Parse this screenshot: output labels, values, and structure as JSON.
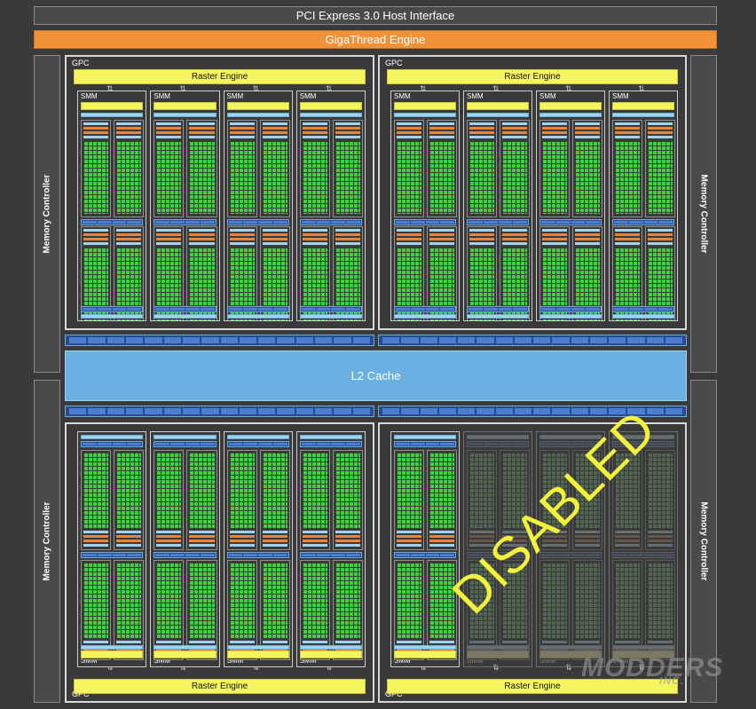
{
  "header": {
    "pcie": "PCI Express 3.0 Host Interface",
    "gigathread": "GigaThread Engine"
  },
  "memory_controller_label": "Memory Controller",
  "l2_cache": "L2 Cache",
  "gpc_label": "GPC",
  "raster_engine_label": "Raster Engine",
  "smm_label": "SMM",
  "disabled_label": "DISABLED",
  "watermark": {
    "main": "MODDERS",
    "sub": "INC."
  },
  "colors": {
    "background": "#3a3a3a",
    "gigathread": "#f0923a",
    "raster": "#f5f560",
    "l2": "#6ab0e0",
    "cores": "#3bd43b",
    "disabled_text": "#f2f23a"
  }
}
